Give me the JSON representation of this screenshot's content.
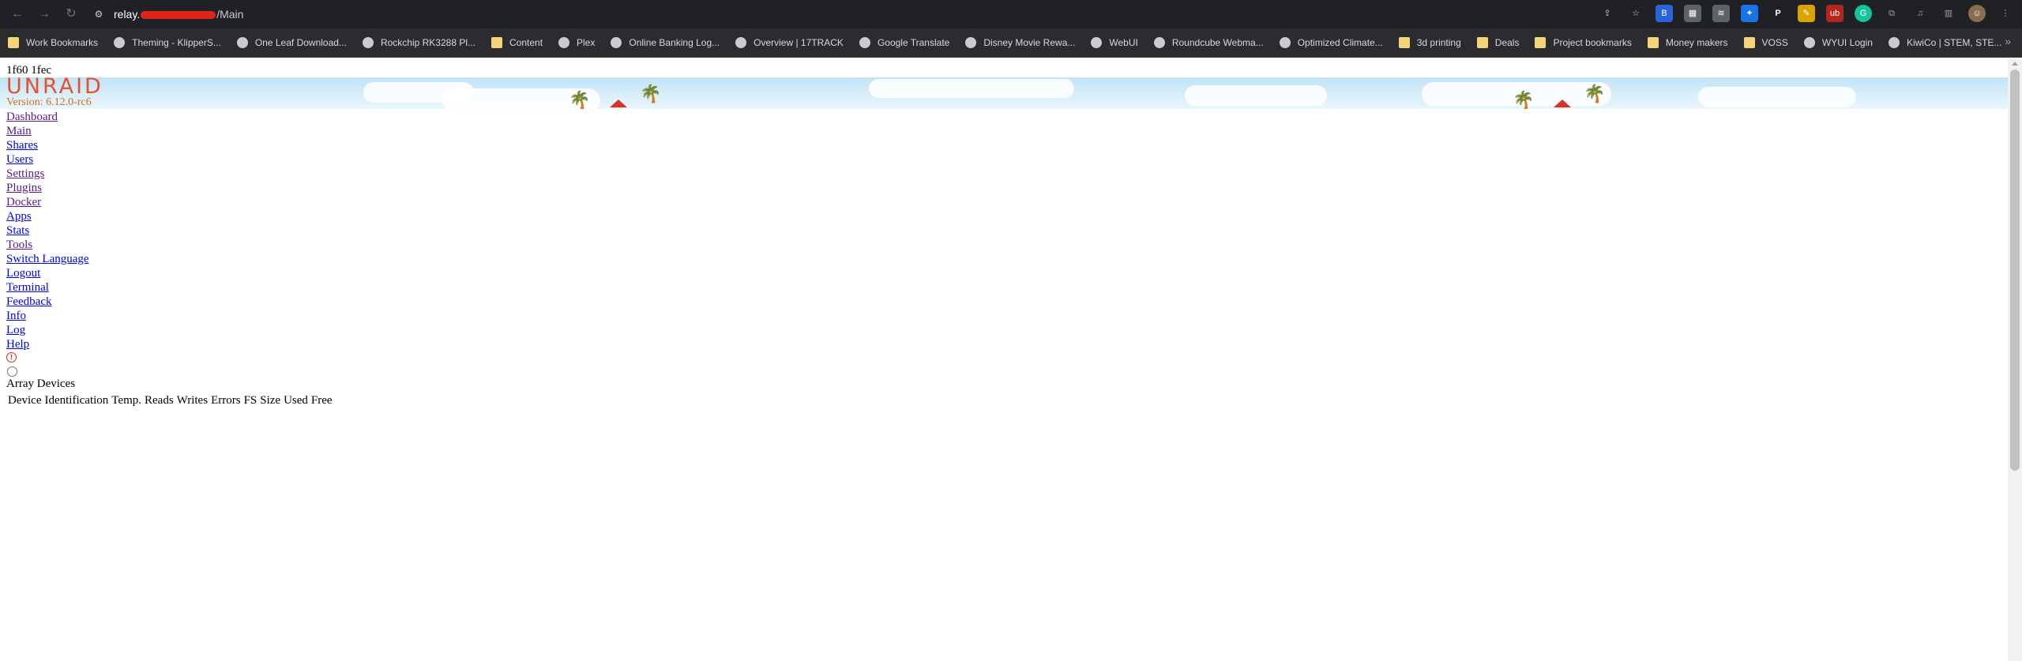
{
  "browser": {
    "url_host": "relay.",
    "url_path": "/Main",
    "bookmarks": [
      {
        "label": "Work Bookmarks",
        "icon": "folder-icon"
      },
      {
        "label": "Theming - KlipperS...",
        "icon": "site-icon"
      },
      {
        "label": "One Leaf Download...",
        "icon": "leaf-icon"
      },
      {
        "label": "Rockchip RK3288 Pl...",
        "icon": "globe-icon"
      },
      {
        "label": "Content",
        "icon": "folder-icon"
      },
      {
        "label": "Plex",
        "icon": "plex-icon"
      },
      {
        "label": "Online Banking Log...",
        "icon": "site-icon"
      },
      {
        "label": "Overview | 17TRACK",
        "icon": "17track-icon"
      },
      {
        "label": "Google Translate",
        "icon": "translate-icon"
      },
      {
        "label": "Disney Movie Rewa...",
        "icon": "site-icon"
      },
      {
        "label": "WebUI",
        "icon": "site-icon"
      },
      {
        "label": "Roundcube Webma...",
        "icon": "mail-icon"
      },
      {
        "label": "Optimized Climate...",
        "icon": "site-icon"
      },
      {
        "label": "3d printing",
        "icon": "folder-icon"
      },
      {
        "label": "Deals",
        "icon": "folder-icon"
      },
      {
        "label": "Project bookmarks",
        "icon": "folder-icon"
      },
      {
        "label": "Money makers",
        "icon": "folder-icon"
      },
      {
        "label": "VOSS",
        "icon": "folder-icon"
      },
      {
        "label": "WYUI Login",
        "icon": "globe-icon"
      },
      {
        "label": "KiwiCo | STEM, STE...",
        "icon": "kiwico-icon"
      }
    ],
    "more_bookmarks": "»"
  },
  "page": {
    "hash_text": "1f60 1fec",
    "logo": "UNRAID",
    "version": "Version: 6.12.0-rc6",
    "menu": [
      {
        "label": "Dashboard",
        "visited": true
      },
      {
        "label": "Main",
        "visited": true
      },
      {
        "label": "Shares",
        "visited": false
      },
      {
        "label": "Users",
        "visited": false
      },
      {
        "label": "Settings",
        "visited": true
      },
      {
        "label": "Plugins",
        "visited": true
      },
      {
        "label": "Docker",
        "visited": true
      },
      {
        "label": "Apps",
        "visited": false
      },
      {
        "label": "Stats",
        "visited": false
      },
      {
        "label": "Tools",
        "visited": true
      },
      {
        "label": "Switch Language",
        "visited": false
      },
      {
        "label": "Logout",
        "visited": false
      },
      {
        "label": "Terminal",
        "visited": false
      },
      {
        "label": "Feedback",
        "visited": false
      },
      {
        "label": "Info",
        "visited": false
      },
      {
        "label": "Log",
        "visited": false
      },
      {
        "label": "Help",
        "visited": false
      }
    ],
    "section_title": "Array Devices",
    "table_headers": [
      "Device",
      "Identification",
      "Temp.",
      "Reads",
      "Writes",
      "Errors",
      "FS",
      "Size",
      "Used",
      "Free"
    ],
    "colors": {
      "logo": "#e4522f",
      "version": "#d86b1f",
      "link": "#0000ee",
      "visited_link": "#551a8b"
    }
  }
}
